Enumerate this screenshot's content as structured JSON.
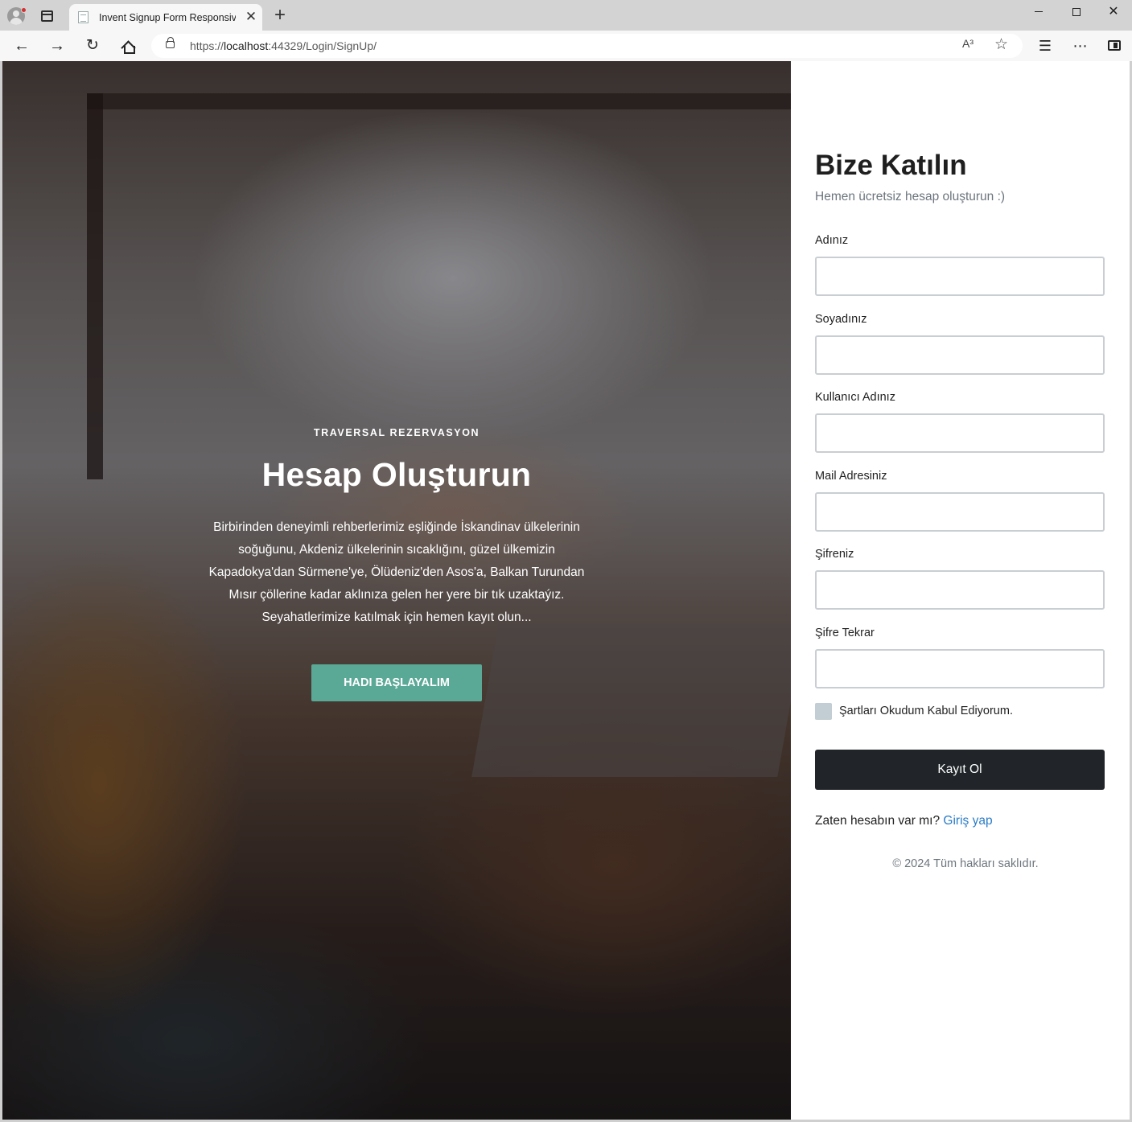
{
  "browser": {
    "tab_title": "Invent Signup Form Responsive W",
    "url_prefix": "https://",
    "url_host": "localhost",
    "url_path": ":44329/Login/SignUp/",
    "read_aloud": "A³"
  },
  "icons": {
    "back": "←",
    "forward": "→",
    "reload": "↻",
    "close": "✕",
    "new_tab": "+",
    "star": "☆",
    "favorites": "☰",
    "more": "⋯"
  },
  "hero": {
    "eyebrow": "TRAVERSAL REZERVASYON",
    "title": "Hesap Oluşturun",
    "text": "Birbirinden deneyimli rehberlerimiz eşliğinde İskandinav ülkelerinin soğuğunu, Akdeniz ülkelerinin sıcaklığını, güzel ülkemizin Kapadokya'dan Sürmene'ye, Ölüdeniz'den Asos'a, Balkan Turundan Mısır çöllerine kadar aklınıza gelen her yere bir tık uzaktaýız. Seyahatlerimize katılmak için hemen kayıt olun...",
    "button": "HADI BAŞLAYALIM"
  },
  "form": {
    "title": "Bize Katılın",
    "subtitle": "Hemen ücretsiz hesap oluşturun :)",
    "fields": [
      {
        "label": "Adınız",
        "value": ""
      },
      {
        "label": "Soyadınız",
        "value": ""
      },
      {
        "label": "Kullanıcı Adınız",
        "value": ""
      },
      {
        "label": "Mail Adresiniz",
        "value": ""
      },
      {
        "label": "Şifreniz",
        "value": ""
      },
      {
        "label": "Şifre Tekrar",
        "value": ""
      }
    ],
    "terms_label": "Şartları Okudum Kabul Ediyorum.",
    "terms_checked": false,
    "submit": "Kayıt Ol",
    "login_prompt": "Zaten hesabın var mı?",
    "login_link": "Giriş yap",
    "copyright": "© 2024 Tüm hakları saklıdır."
  }
}
